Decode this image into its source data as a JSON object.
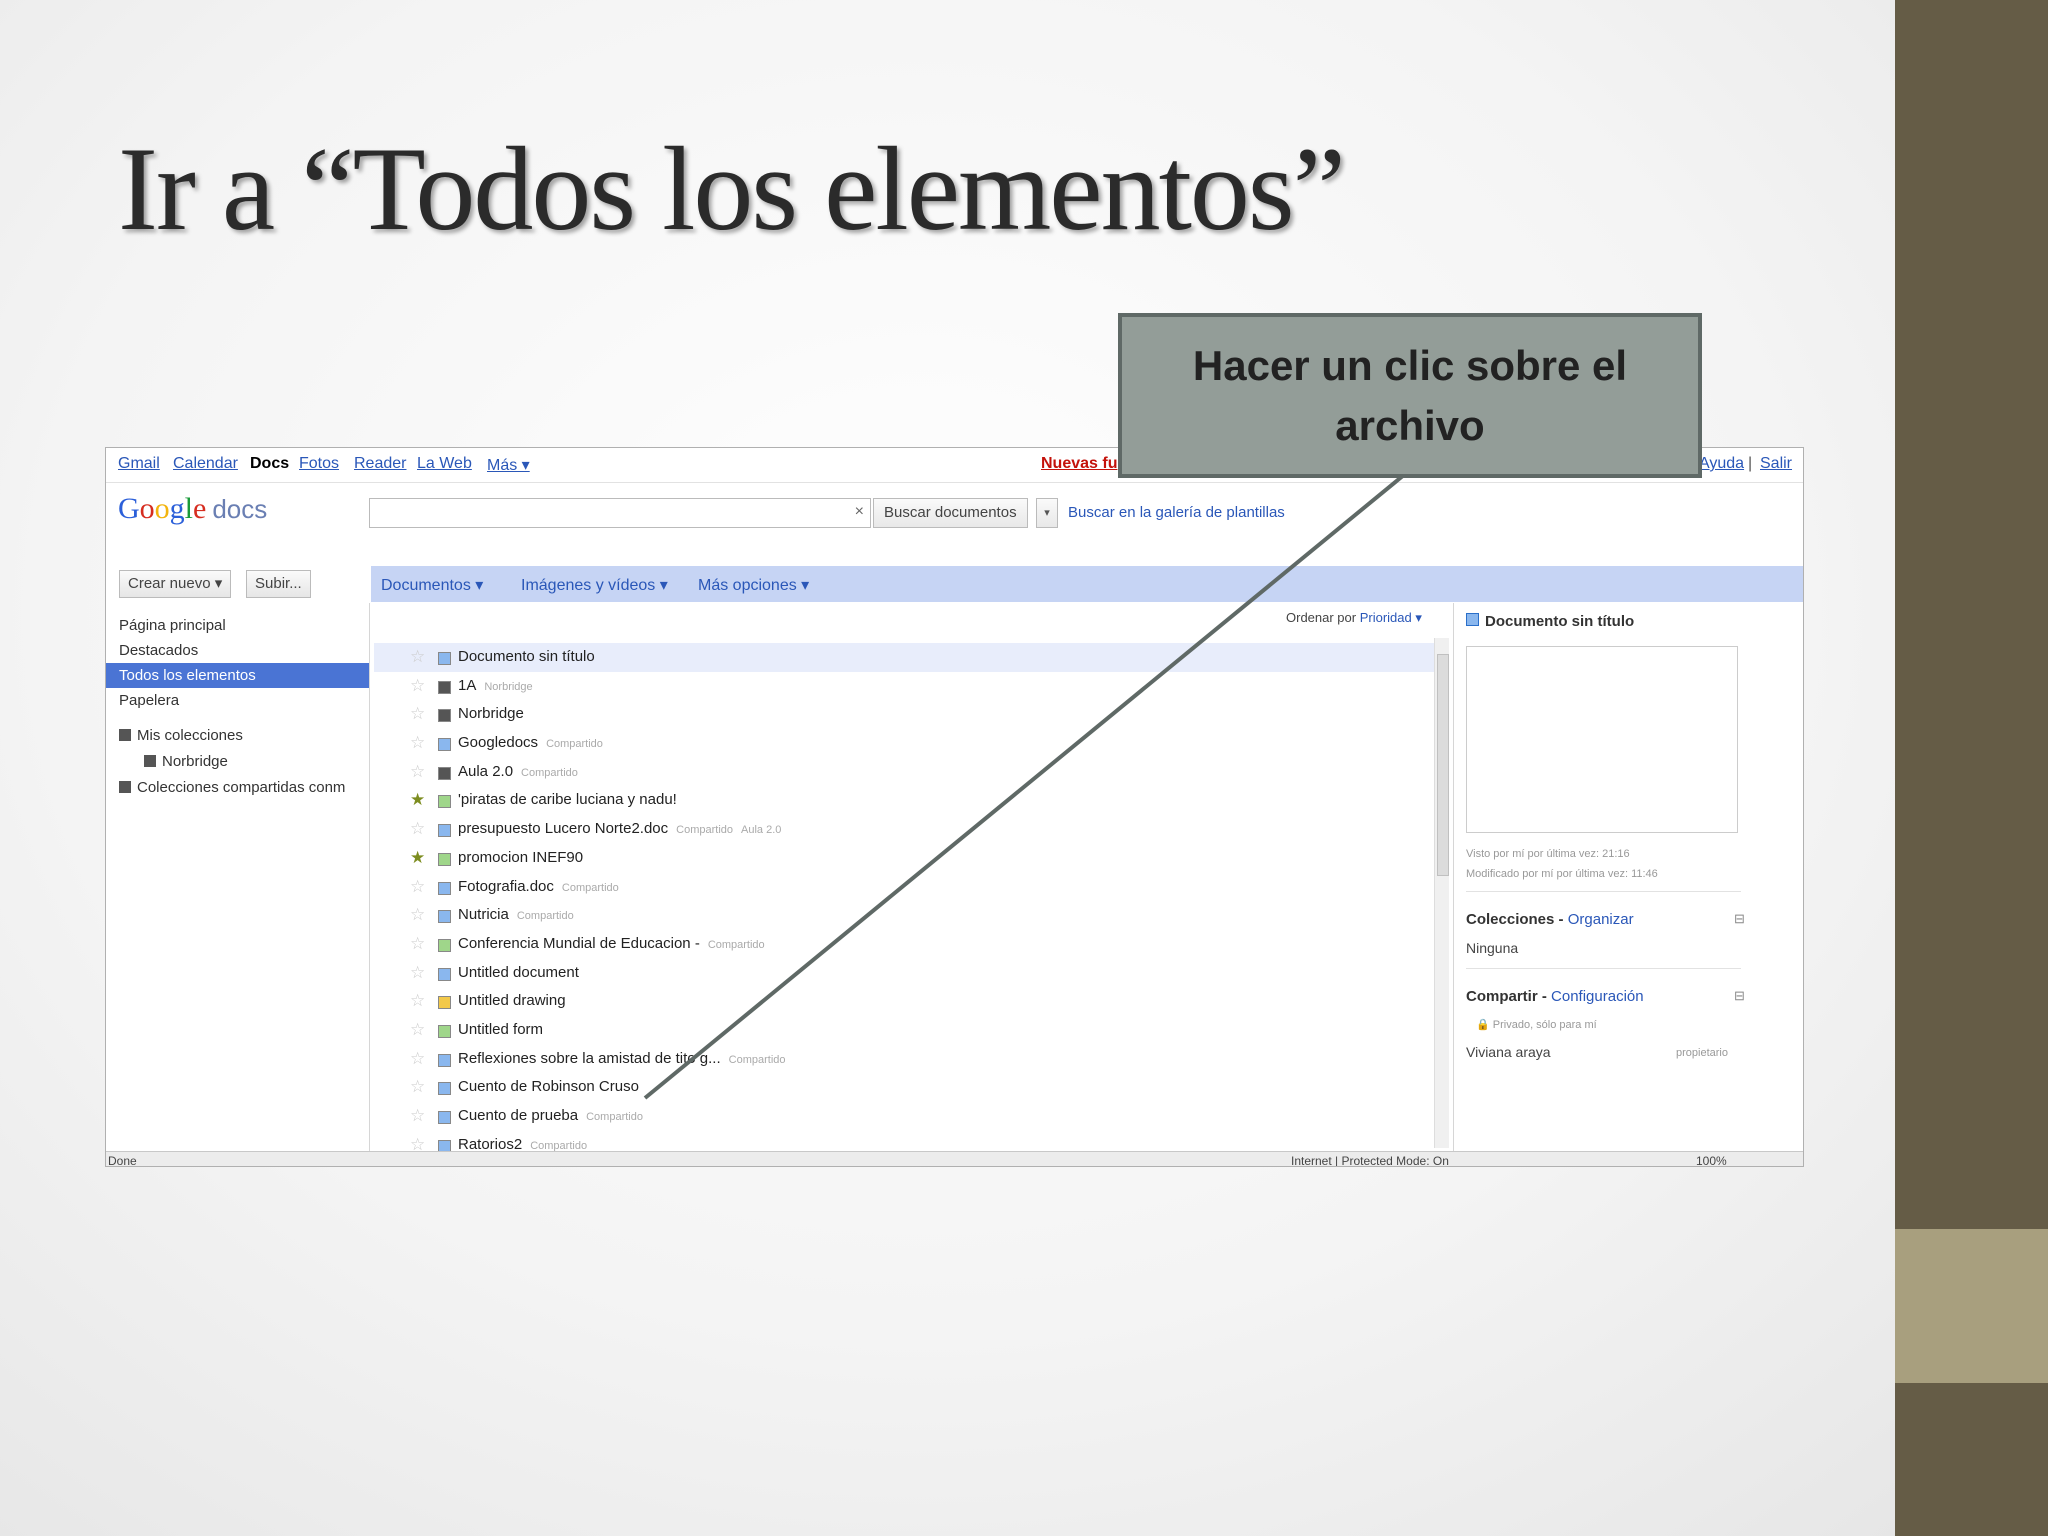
{
  "slide": {
    "title": "Ir a “Todos los elementos”",
    "callout": "Hacer un clic sobre el archivo"
  },
  "colors": {
    "bar_dark": "#655c46",
    "bar_light": "#a89f7e",
    "callout_bg": "#939d98",
    "selected": "#4a74d4"
  },
  "gbar": {
    "links": [
      "Gmail",
      "Calendar",
      "Docs",
      "Fotos",
      "Reader",
      "La Web",
      "Más ▾"
    ],
    "nuevas": "Nuevas fu",
    "right": [
      "Ayuda",
      "|",
      "Salir"
    ]
  },
  "app": {
    "logo": {
      "g": "G",
      "o1": "o",
      "o2": "o",
      "g2": "g",
      "l": "l",
      "e": "e",
      "docs": "docs"
    },
    "search_placeholder": "",
    "search_clear": "×",
    "search_button": "Buscar documentos",
    "search_dropdown": "▾",
    "gallery_link": "Buscar en la galería de plantillas"
  },
  "left": {
    "create_button": "Crear nuevo ▾",
    "upload_button": "Subir...",
    "nav": [
      "Página principal",
      "Destacados",
      "Todos los elementos",
      "Papelera"
    ],
    "collections": [
      "Mis colecciones",
      "Norbridge",
      "Colecciones compartidas conm"
    ]
  },
  "toolbar": [
    "Documentos ▾",
    "Imágenes y vídeos ▾",
    "Más opciones ▾"
  ],
  "sort": {
    "label": "Ordenar por",
    "value": "Prioridad ▾"
  },
  "files": [
    {
      "name": "Documento sin título",
      "tag": "",
      "tag2": "",
      "star": false,
      "color": "#8ab7ee"
    },
    {
      "name": "1A",
      "tag": "Norbridge",
      "tag2": "",
      "star": false,
      "color": "#555"
    },
    {
      "name": "Norbridge",
      "tag": "",
      "tag2": "",
      "star": false,
      "color": "#555"
    },
    {
      "name": "Googledocs",
      "tag": "Compartido",
      "tag2": "",
      "star": false,
      "color": "#8ab7ee"
    },
    {
      "name": "Aula 2.0",
      "tag": "Compartido",
      "tag2": "",
      "star": false,
      "color": "#555"
    },
    {
      "name": "'piratas de caribe luciana y nadu!",
      "tag": "",
      "tag2": "",
      "star": true,
      "color": "#9fd68a"
    },
    {
      "name": "presupuesto Lucero Norte2.doc",
      "tag": "Compartido",
      "tag2": "Aula 2.0",
      "star": false,
      "color": "#8ab7ee"
    },
    {
      "name": "promocion INEF90",
      "tag": "",
      "tag2": "",
      "star": true,
      "color": "#9fd68a"
    },
    {
      "name": "Fotografia.doc",
      "tag": "Compartido",
      "tag2": "",
      "star": false,
      "color": "#8ab7ee"
    },
    {
      "name": "Nutricia",
      "tag": "Compartido",
      "tag2": "",
      "star": false,
      "color": "#8ab7ee"
    },
    {
      "name": "Conferencia Mundial de Educacion -",
      "tag": "Compartido",
      "tag2": "",
      "star": false,
      "color": "#9fd68a"
    },
    {
      "name": "Untitled document",
      "tag": "",
      "tag2": "",
      "star": false,
      "color": "#8ab7ee"
    },
    {
      "name": "Untitled drawing",
      "tag": "",
      "tag2": "",
      "star": false,
      "color": "#f3c94a"
    },
    {
      "name": "Untitled form",
      "tag": "",
      "tag2": "",
      "star": false,
      "color": "#9fd68a"
    },
    {
      "name": "Reflexiones sobre la amistad de tito g...",
      "tag": "Compartido",
      "tag2": "",
      "star": false,
      "color": "#8ab7ee"
    },
    {
      "name": "Cuento de Robinson Cruso",
      "tag": "",
      "tag2": "",
      "star": false,
      "color": "#8ab7ee"
    },
    {
      "name": "Cuento de prueba",
      "tag": "Compartido",
      "tag2": "",
      "star": false,
      "color": "#8ab7ee"
    },
    {
      "name": "Ratorios2",
      "tag": "Compartido",
      "tag2": "",
      "star": false,
      "color": "#8ab7ee"
    }
  ],
  "details": {
    "title": "Documento sin título",
    "viewed": "Visto por mí por última vez: 21:16",
    "modified": "Modificado por mí por última vez: 11:46",
    "collections_label": "Colecciones",
    "collections_link": "Organizar",
    "collections_value": "Ninguna",
    "share_label": "Compartir",
    "share_link": "Configuración",
    "privacy": "Privado, sólo para mí",
    "owner_name": "Viviana araya",
    "owner_role": "propietario",
    "collapse": "⊟"
  },
  "statusbar": {
    "left": "Done",
    "zone": "Internet | Protected Mode: On",
    "zoom": "100%"
  }
}
